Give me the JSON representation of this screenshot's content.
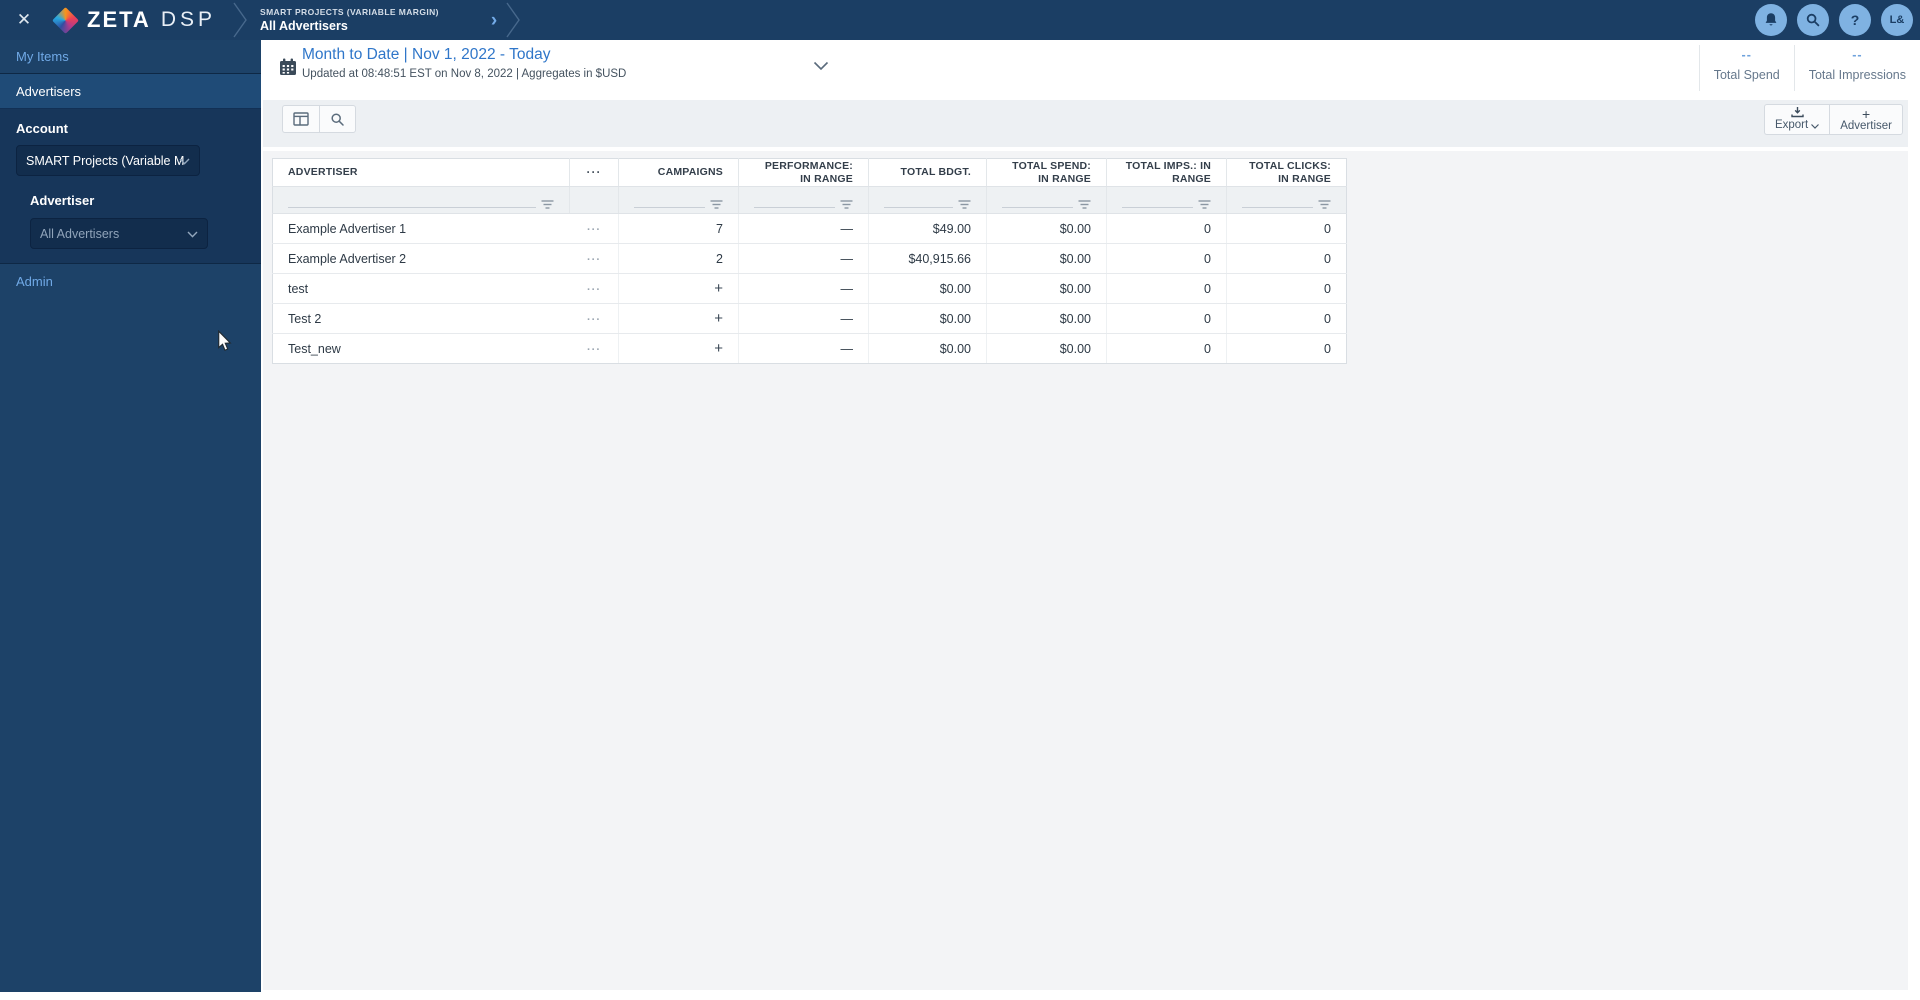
{
  "colors": {
    "navy_bar": "#1b3e64",
    "navy_side": "#1d4268",
    "navy_active": "#1f4b77",
    "navy_section": "#17365a",
    "navy_input": "#122d4d",
    "navy_input_border": "#0c2341",
    "link_blue": "#70a9e6",
    "title_blue": "#2f76c9",
    "stat_blue": "#6ea2dc",
    "circle_blue": "#7fb2e2",
    "text_dark": "#2e3a46",
    "text_gray": "#66788c",
    "panel_gray": "#f3f4f6",
    "toolbar_gray": "#edf0f3",
    "border_gray": "#dfe3e7"
  },
  "icons": {
    "close": "✕",
    "ellipsis": "···",
    "plus": "+",
    "dash": "—",
    "help": "?",
    "breadcrumb_arrow": "›"
  },
  "topbar": {
    "logo_primary": "ZETA",
    "logo_secondary": "DSP",
    "breadcrumb_small": "SMART PROJECTS (VARIABLE MARGIN)",
    "breadcrumb_title": "All Advertisers",
    "avatar_initials": "L&"
  },
  "sidebar": {
    "my_items": "My Items",
    "advertisers": "Advertisers",
    "account_label": "Account",
    "account_value": "SMART Projects (Variable M",
    "advertiser_label": "Advertiser",
    "advertiser_value": "All Advertisers",
    "admin": "Admin"
  },
  "dateheader": {
    "title": "Month to Date | Nov 1, 2022 - Today",
    "subtitle": "Updated at 08:48:51 EST on Nov 8, 2022 | Aggregates in $USD",
    "stats": [
      {
        "value": "--",
        "label": "Total Spend"
      },
      {
        "value": "--",
        "label": "Total Impressions"
      }
    ]
  },
  "toolbar": {
    "export_label": "Export",
    "advertiser_button_label": "Advertiser"
  },
  "table": {
    "columns": [
      {
        "field": "advertiser",
        "label": "ADVERTISER",
        "align": "left",
        "filterable": true
      },
      {
        "field": "menu",
        "label": "",
        "icon": "ellipsis-icon",
        "align": "center",
        "filterable": false
      },
      {
        "field": "campaigns",
        "label": "CAMPAIGNS",
        "align": "right",
        "filterable": true
      },
      {
        "field": "performance",
        "label": "PERFORMANCE: IN RANGE",
        "align": "right",
        "filterable": true
      },
      {
        "field": "total_bdgt",
        "label": "TOTAL BDGT.",
        "align": "right",
        "filterable": true
      },
      {
        "field": "total_spend",
        "label": "TOTAL SPEND: IN RANGE",
        "align": "right",
        "filterable": true
      },
      {
        "field": "total_imps",
        "label": "TOTAL IMPS.: IN RANGE",
        "align": "right",
        "filterable": true
      },
      {
        "field": "total_clicks",
        "label": "TOTAL CLICKS: IN RANGE",
        "align": "right",
        "filterable": true
      }
    ],
    "rows": [
      {
        "advertiser": "Example Advertiser 1",
        "menu": "···",
        "campaigns": "7",
        "performance": "—",
        "total_bdgt": "$49.00",
        "total_spend": "$0.00",
        "total_imps": "0",
        "total_clicks": "0"
      },
      {
        "advertiser": "Example Advertiser 2",
        "menu": "···",
        "campaigns": "2",
        "performance": "—",
        "total_bdgt": "$40,915.66",
        "total_spend": "$0.00",
        "total_imps": "0",
        "total_clicks": "0"
      },
      {
        "advertiser": "test",
        "menu": "···",
        "campaigns": "+",
        "performance": "—",
        "total_bdgt": "$0.00",
        "total_spend": "$0.00",
        "total_imps": "0",
        "total_clicks": "0"
      },
      {
        "advertiser": "Test 2",
        "menu": "···",
        "campaigns": "+",
        "performance": "—",
        "total_bdgt": "$0.00",
        "total_spend": "$0.00",
        "total_imps": "0",
        "total_clicks": "0"
      },
      {
        "advertiser": "Test_new",
        "menu": "···",
        "campaigns": "+",
        "performance": "—",
        "total_bdgt": "$0.00",
        "total_spend": "$0.00",
        "total_imps": "0",
        "total_clicks": "0"
      }
    ]
  }
}
